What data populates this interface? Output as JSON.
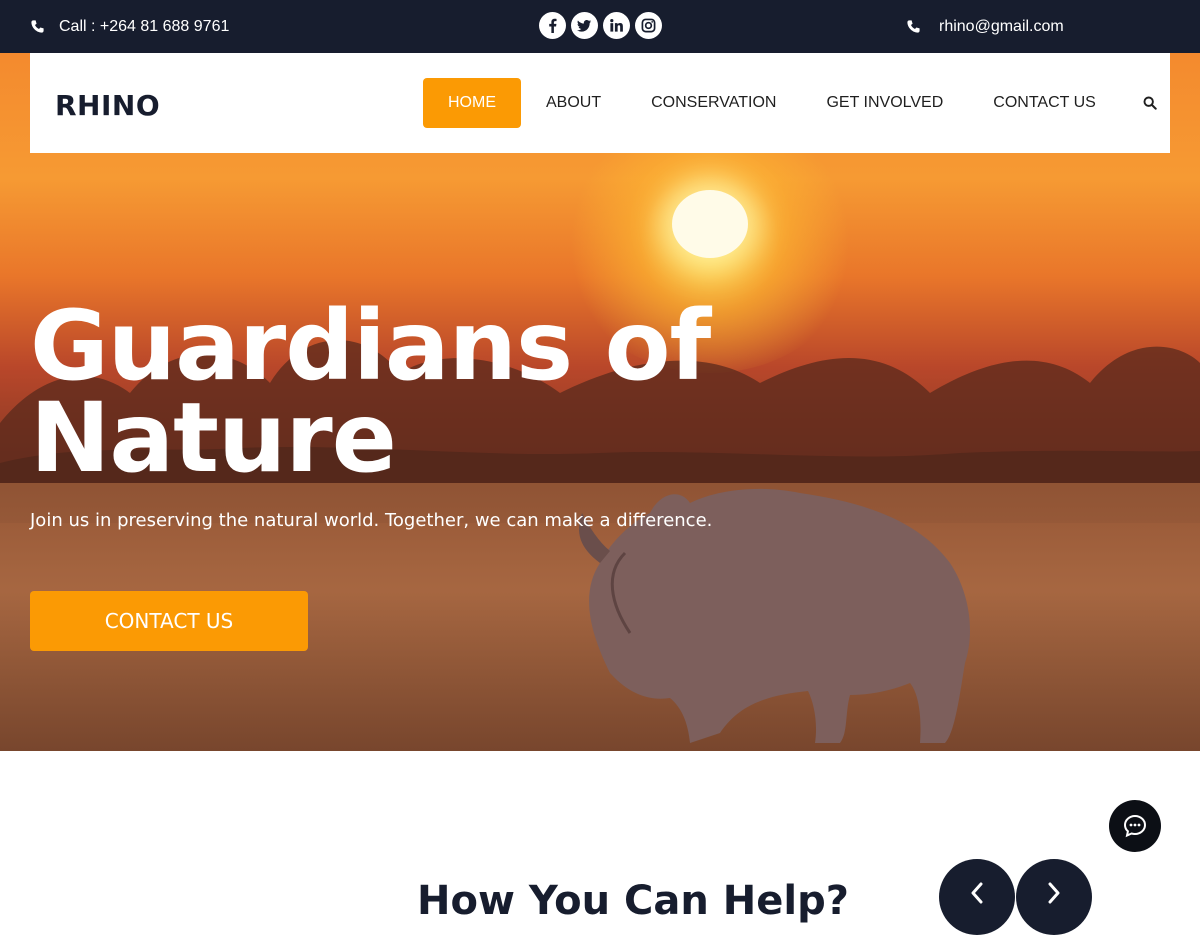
{
  "topbar": {
    "phone_text": "Call : +264 81 688 9761",
    "email_text": "rhino@gmail.com",
    "socials": [
      {
        "name": "facebook",
        "glyph": "f"
      },
      {
        "name": "twitter",
        "glyph": ""
      },
      {
        "name": "linkedin",
        "glyph": "in"
      },
      {
        "name": "instagram",
        "glyph": ""
      }
    ]
  },
  "header": {
    "logo": "RHINO",
    "nav": {
      "home": "HOME",
      "about": "ABOUT",
      "conservation": "CONSERVATION",
      "get_involved": "GET INVOLVED",
      "contact": "CONTACT US"
    }
  },
  "hero": {
    "title_line1": "Guardians of",
    "title_line2": "Nature",
    "subtitle": "Join us in preserving the natural world. Together, we can make a difference.",
    "button": "CONTACT US"
  },
  "section": {
    "title": "How You Can Help?"
  },
  "colors": {
    "accent": "#fb9a04",
    "dark": "#171d2e"
  }
}
